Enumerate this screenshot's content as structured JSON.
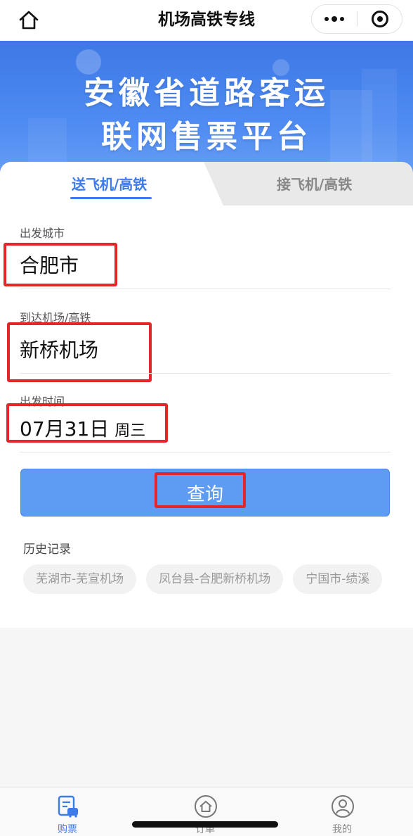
{
  "navbar": {
    "title": "机场高铁专线",
    "home_icon": "home-icon",
    "more_icon": "more-dots-icon",
    "close_icon": "target-close-icon"
  },
  "banner": {
    "line1": "安徽省道路客运",
    "line2": "联网售票平台"
  },
  "tabs": [
    {
      "label": "送飞机/高铁",
      "active": true
    },
    {
      "label": "接飞机/高铁",
      "active": false
    }
  ],
  "form": {
    "departure_city": {
      "label": "出发城市",
      "value": "合肥市"
    },
    "destination": {
      "label": "到达机场/高铁",
      "value": "新桥机场"
    },
    "departure_time": {
      "label": "出发时间",
      "date": "07月31日",
      "weekday": "周三"
    },
    "search_label": "查询"
  },
  "history": {
    "title": "历史记录",
    "items": [
      "芜湖市-芜宣机场",
      "凤台县-合肥新桥机场",
      "宁国市-绩溪"
    ]
  },
  "tabbar": {
    "items": [
      {
        "label": "购票",
        "icon": "ticket-bus-icon",
        "active": true
      },
      {
        "label": "订单",
        "icon": "home-circle-icon",
        "active": false
      },
      {
        "label": "我的",
        "icon": "user-circle-icon",
        "active": false
      }
    ]
  },
  "colors": {
    "accent": "#3d7be8",
    "button": "#5e9bf2",
    "highlight_box": "#e3262a"
  }
}
